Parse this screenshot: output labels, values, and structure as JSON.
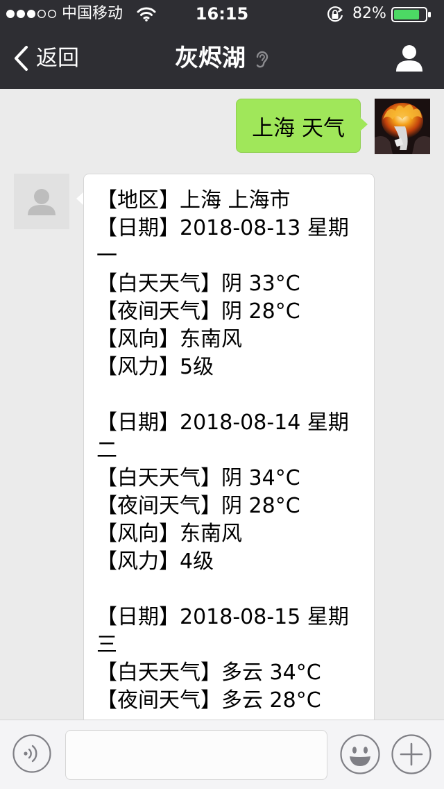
{
  "status_bar": {
    "carrier": "中国移动",
    "time": "16:15",
    "battery": "82%",
    "battery_level": 0.82
  },
  "nav": {
    "back_label": "返回",
    "title": "灰烬湖"
  },
  "messages": {
    "outgoing": {
      "text": "上海 天气"
    },
    "incoming": {
      "lines": [
        "【地区】上海 上海市",
        "【日期】2018-08-13 星期",
        "一",
        "【白天天气】阴 33°C",
        "【夜间天气】阴 28°C",
        "【风向】东南风",
        "【风力】5级",
        "",
        "【日期】2018-08-14 星期",
        "二",
        "【白天天气】阴 34°C",
        "【夜间天气】阴 28°C",
        "【风向】东南风",
        "【风力】4级",
        "",
        "【日期】2018-08-15 星期",
        "三",
        "【白天天气】多云 34°C",
        "【夜间天气】多云 28°C"
      ]
    }
  },
  "input_bar": {
    "text_value": "",
    "icons": [
      "voice-icon",
      "emoji-icon",
      "plus-icon"
    ]
  },
  "colors": {
    "nav_background": "#2e2e33",
    "chat_background": "#ebebeb",
    "outgoing_bubble": "#a0e75a",
    "incoming_bubble": "#ffffff",
    "battery_fill": "#4cd964"
  }
}
